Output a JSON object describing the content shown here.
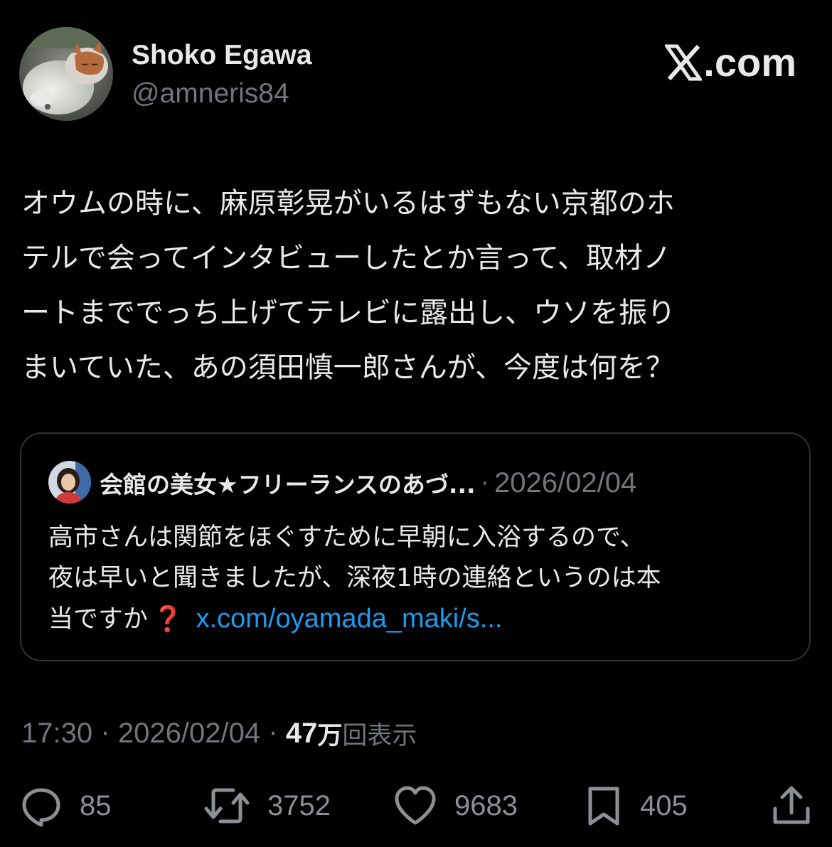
{
  "author": {
    "display_name": "Shoko Egawa",
    "handle": "@amneris84",
    "avatar_icon": "cat-avatar"
  },
  "brand": {
    "logo_icon": "x-logo-icon",
    "text": ".com"
  },
  "tweet": {
    "lines": [
      "オウムの時に、麻原彰晃がいるはずもない京都のホ",
      "テルで会ってインタビューしたとか言って、取材ノ",
      "ートまででっち上げてテレビに露出し、ウソを振り",
      "まいていた、あの須田慎一郎さんが、今度は何を？"
    ]
  },
  "quote": {
    "author": "会館の美女★フリーランスのあづ...",
    "separator": "·",
    "date": "2026/02/04",
    "lines": [
      "高市さんは関節をほぐすために早朝に入浴するので、",
      "夜は早いと聞きましたが、深夜1時の連絡というのは本"
    ],
    "last_line_text": "当ですか",
    "emoji": "❓",
    "link": "x.com/oyamada_maki/s..."
  },
  "meta": {
    "time": "17:30",
    "separator": "·",
    "date": "2026/02/04",
    "views_number": "47",
    "views_unit": "万",
    "views_label": "回表示"
  },
  "actions": {
    "replies": "85",
    "reposts": "3752",
    "likes": "9683",
    "bookmarks": "405"
  },
  "colors": {
    "background": "#000000",
    "text_primary": "#e7e9ea",
    "text_secondary": "#71767b",
    "border": "#2f3336",
    "link": "#1d9bf0",
    "emoji_red": "#e0262f"
  }
}
